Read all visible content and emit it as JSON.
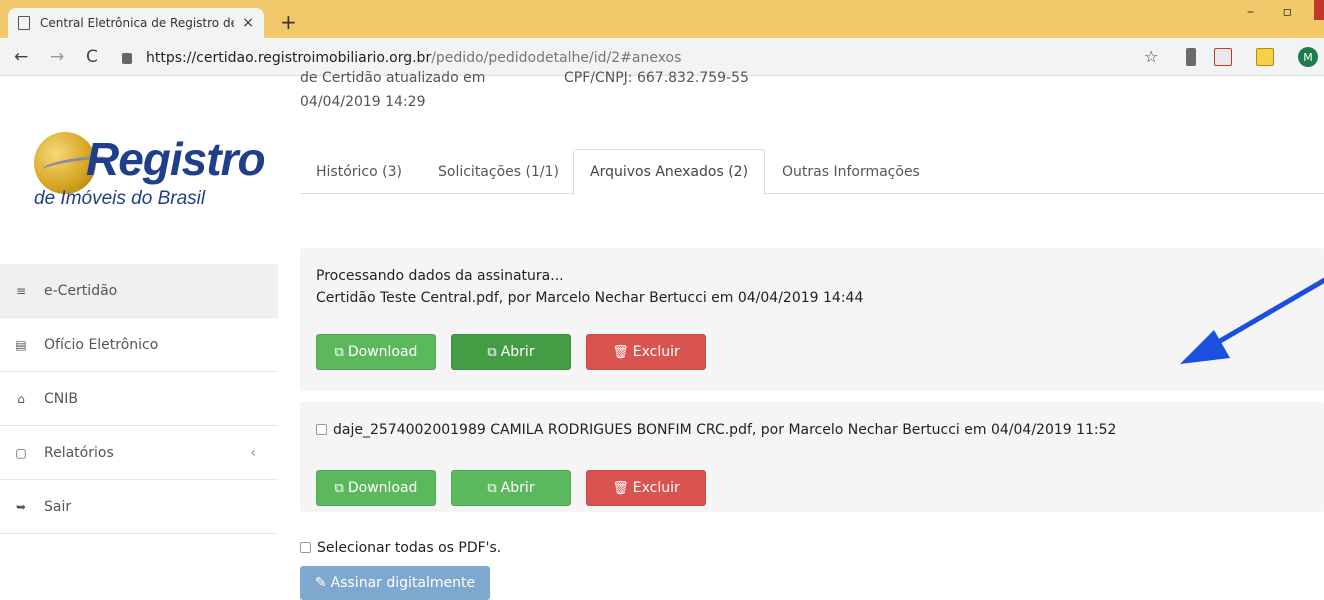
{
  "browser": {
    "tab_title": "Central Eletrônica de Registro de",
    "tab_close": "×",
    "new_tab": "+",
    "window_controls": "– ▫",
    "nav_back": "←",
    "nav_forward": "→",
    "nav_reload": "C",
    "url_host": "https://certidao.registroimobiliario.org.br",
    "url_path": "/pedido/pedidodetalhe/id/2#anexos",
    "star": "☆",
    "profile_initial": "M"
  },
  "sidebar": {
    "logo_title": "Registro",
    "logo_subtitle": "de Imóveis do Brasil",
    "items": [
      {
        "label": "e-Certidão",
        "icon": "≡"
      },
      {
        "label": "Ofício Eletrônico",
        "icon": "▤"
      },
      {
        "label": "CNIB",
        "icon": "⌂"
      },
      {
        "label": "Relatórios",
        "icon": "▢",
        "chevron": "‹"
      },
      {
        "label": "Sair",
        "icon": "➥"
      }
    ]
  },
  "header": {
    "cut_left": "de Certidão atualizado em",
    "cut_right": "CPF/CNPJ: 667.832.759-55",
    "updated_at": "04/04/2019 14:29"
  },
  "tabs": [
    {
      "label": "Histórico (3)"
    },
    {
      "label": "Solicitações (1/1)"
    },
    {
      "label": "Arquivos Anexados (2)"
    },
    {
      "label": "Outras Informações"
    }
  ],
  "attachments": [
    {
      "status": "Processando dados da assinatura...",
      "file_line": "Certidão Teste Central.pdf, por Marcelo Nechar Bertucci em 04/04/2019 14:44",
      "download": "Download",
      "open": "Abrir",
      "delete": "Excluir"
    },
    {
      "file_line": "daje_2574002001989 CAMILA RODRIGUES BONFIM CRC.pdf, por Marcelo Nechar Bertucci em 04/04/2019 11:52",
      "download": "Download",
      "open": "Abrir",
      "delete": "Excluir"
    }
  ],
  "select_all": "Selecionar todas os PDF's.",
  "sign_button": "Assinar digitalmente",
  "colors": {
    "success": "#5cb85c",
    "success_active": "#449d44",
    "danger": "#d9534f",
    "primary_disabled": "#7fa8cf",
    "annotation_arrow": "#1a4fe0",
    "tabstrip": "#f2c96a"
  }
}
